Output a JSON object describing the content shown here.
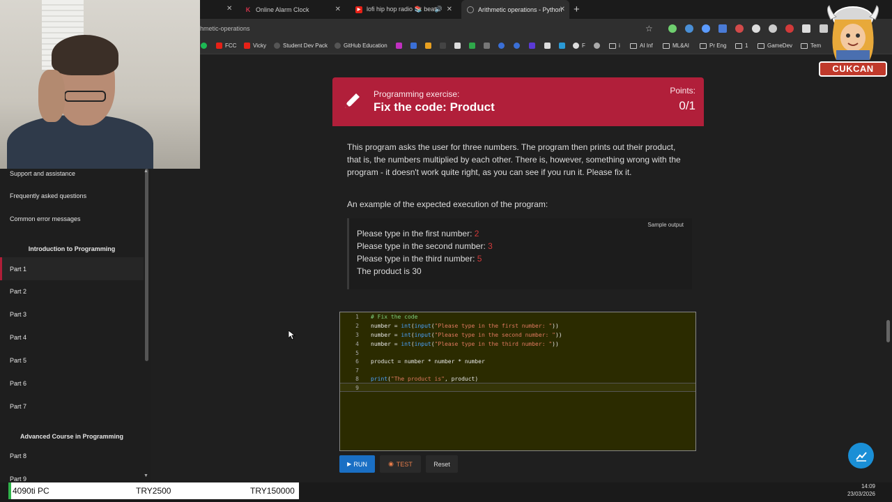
{
  "browser": {
    "tabs": [
      {
        "label": "Online Alarm Clock",
        "favicon": "K",
        "favicon_color": "#d2334c"
      },
      {
        "label": "lofi hip hop radio 📚 beats",
        "favicon": "▶",
        "favicon_color": "#e62117"
      },
      {
        "label": "Arithmetic operations - Python",
        "favicon": "◐",
        "favicon_color": "#888888",
        "active": true
      }
    ],
    "url": "hmetic-operations",
    "bookmarks": [
      "FCC",
      "Vicky",
      "Student Dev Pack",
      "GitHub Education",
      "F",
      "i",
      "AI Inf",
      "ML&AI",
      "Pr Eng",
      "1",
      "GameDev",
      "Tem"
    ]
  },
  "sidebar": {
    "items_top": [
      "Support and assistance",
      "Frequently asked questions",
      "Common error messages"
    ],
    "heading_intro": "Introduction to Programming",
    "parts": [
      "Part 1",
      "Part 2",
      "Part 3",
      "Part 4",
      "Part 5",
      "Part 6",
      "Part 7"
    ],
    "heading_advanced": "Advanced Course in Programming",
    "parts_advanced": [
      "Part 8",
      "Part 9"
    ]
  },
  "exercise": {
    "label": "Programming exercise:",
    "title": "Fix the code: Product",
    "points_label": "Points:",
    "points_value": "0/1",
    "description": "This program asks the user for three numbers. The program then prints out their product, that is, the numbers multiplied by each other. There is, however, something wrong with the program - it doesn't work quite right, as you can see if you run it. Please fix it.",
    "example_intro": "An example of the expected execution of the program:",
    "sample_label": "Sample output",
    "sample": [
      {
        "text": "Please type in the first number: ",
        "input": "2"
      },
      {
        "text": "Please type in the second number: ",
        "input": "3"
      },
      {
        "text": "Please type in the third number: ",
        "input": "5"
      },
      {
        "text": "The product is 30",
        "input": ""
      }
    ]
  },
  "editor": {
    "lines": [
      "1",
      "2",
      "3",
      "4",
      "5",
      "6",
      "7",
      "8",
      "9"
    ],
    "code": {
      "l1_comment": "# Fix the code",
      "l2_pre": "number = ",
      "l2_int": "int",
      "l2_input": "input",
      "l2_str": "\"Please type in the first number: \"",
      "l2_post": "))",
      "l3_pre": "number = ",
      "l3_int": "int",
      "l3_input": "input",
      "l3_str": "\"Please type in the second number: \"",
      "l3_post": "))",
      "l4_pre": "number = ",
      "l4_int": "int",
      "l4_input": "input",
      "l4_str": "\"Please type in the third number: \"",
      "l4_post": "))",
      "l6": "product = number * number * number",
      "l8_print": "print",
      "l8_str": "\"The product is\"",
      "l8_post": ", product)"
    }
  },
  "buttons": {
    "run": "RUN",
    "test": "TEST",
    "reset": "Reset"
  },
  "taskbar": {
    "ticker": [
      "4090ti PC",
      "TRY2500",
      "TRY150000"
    ],
    "time": "14:09",
    "date": "23/03/2026"
  },
  "logo_text": "CUKCAN",
  "colors": {
    "accent": "#b11f3a",
    "run": "#1a6fc4",
    "test": "#e87d4a",
    "fab": "#1a8fd6"
  }
}
